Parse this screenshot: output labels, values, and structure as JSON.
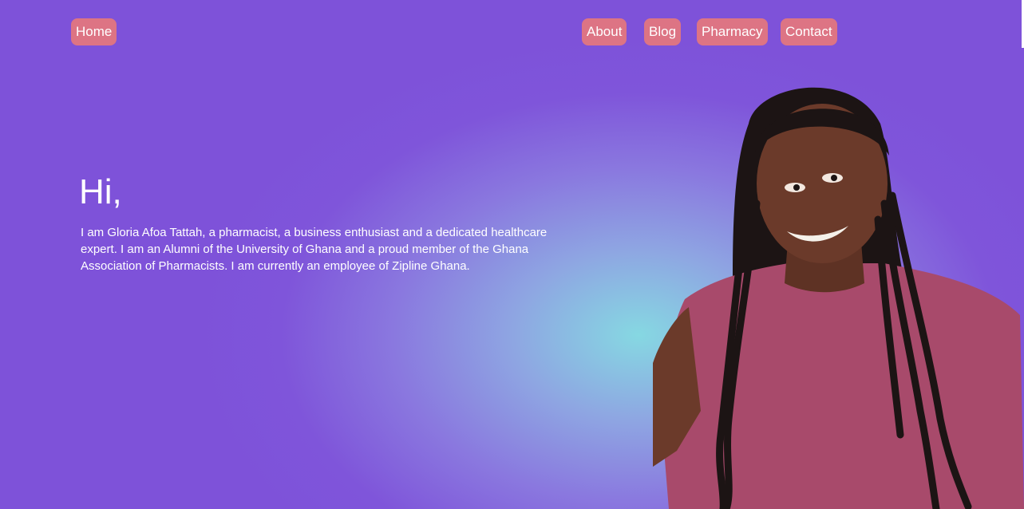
{
  "nav": {
    "home": "Home",
    "about": "About",
    "blog": "Blog",
    "pharmacy": "Pharmacy",
    "contact": "Contact"
  },
  "hero": {
    "greeting": "Hi,",
    "bio": "I am Gloria Afoa Tattah, a pharmacist, a business enthusiast and a dedicated healthcare expert. I am an Alumni of the University of Ghana and a proud member of the Ghana Association of Pharmacists. I am currently an employee of Zipline Ghana."
  },
  "colors": {
    "background": "#7e52d9",
    "glow": "#86d8e2",
    "nav_button": "#dd7484",
    "text": "#ffffff",
    "shirt": "#a84a6b",
    "skin": "#6b3a2a",
    "hair": "#1c1414"
  },
  "portrait": {
    "icon": "person-photo"
  }
}
